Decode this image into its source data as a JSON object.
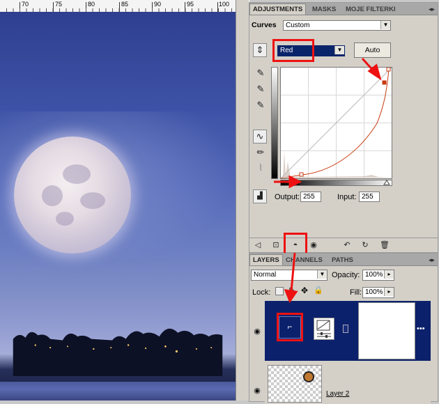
{
  "ruler": {
    "ticks": [
      "70",
      "75",
      "80",
      "85",
      "90",
      "95",
      "100"
    ]
  },
  "adjustments": {
    "tabs": [
      "ADJUSTMENTS",
      "MASKS",
      "MOJE FILTERKI"
    ],
    "panel_menu_icon": "panel-menu-icon",
    "preset_label": "Curves",
    "preset_value": "Custom",
    "channel_value": "Red",
    "auto_label": "Auto",
    "output_label": "Output:",
    "output_value": "255",
    "input_label": "Input:",
    "input_value": "255",
    "curve_color": "#c83a10"
  },
  "layers": {
    "tabs": [
      "LAYERS",
      "CHANNELS",
      "PATHS"
    ],
    "blend_mode": "Normal",
    "opacity_label": "Opacity:",
    "opacity_value": "100%",
    "lock_label": "Lock:",
    "fill_label": "Fill:",
    "fill_value": "100%",
    "layer_2_name": "Layer 2",
    "selected_row_color": "#0c216b"
  },
  "annotations": {
    "highlight_color": "#ee1111"
  }
}
